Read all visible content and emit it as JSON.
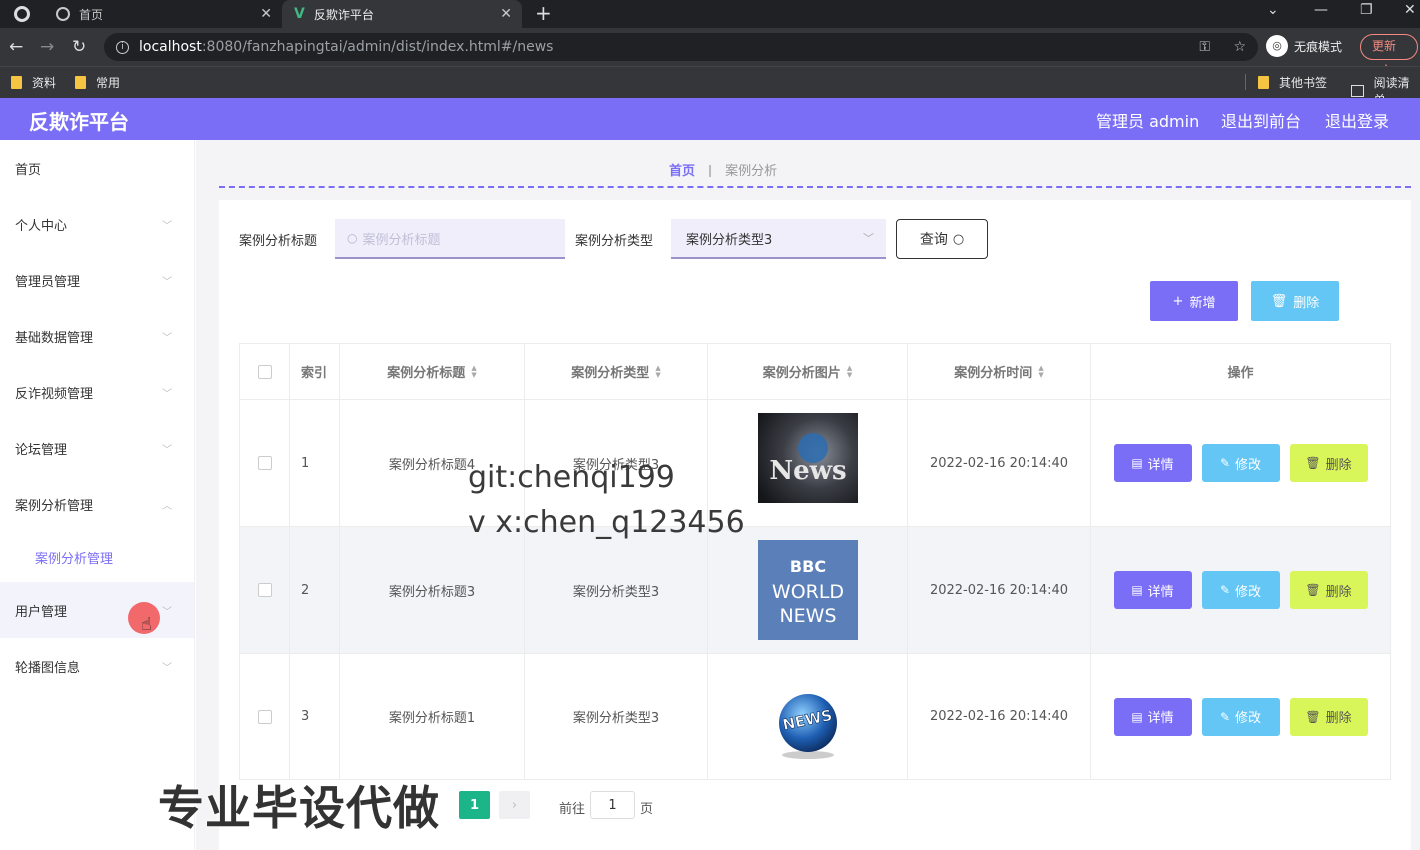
{
  "browser": {
    "tabs": [
      {
        "title": "首页"
      },
      {
        "title": "反欺诈平台"
      }
    ],
    "url_host": "localhost",
    "url_path": ":8080/fanzhapingtai/admin/dist/index.html#/news",
    "incognito_label": "无痕模式",
    "update_label": "更新",
    "bookmarks": [
      "资料",
      "常用",
      "其他书签",
      "阅读清单"
    ]
  },
  "header": {
    "brand": "反欺诈平台",
    "admin_label": "管理员 admin",
    "front_label": "退出到前台",
    "logout_label": "退出登录"
  },
  "sidebar": {
    "items": [
      "首页",
      "个人中心",
      "管理员管理",
      "基础数据管理",
      "反诈视频管理",
      "论坛管理",
      "案例分析管理",
      "用户管理",
      "轮播图信息"
    ],
    "sub_item": "案例分析管理"
  },
  "breadcrumb": {
    "home": "首页",
    "current": "案例分析"
  },
  "search": {
    "title_label": "案例分析标题",
    "title_placeholder": "案例分析标题",
    "type_label": "案例分析类型",
    "type_value": "案例分析类型3",
    "query_label": "查询"
  },
  "toolbar": {
    "add_label": "新增",
    "delete_label": "删除"
  },
  "table": {
    "columns": [
      "索引",
      "案例分析标题",
      "案例分析类型",
      "案例分析图片",
      "案例分析时间",
      "操作"
    ],
    "rows": [
      {
        "index": "1",
        "title": "案例分析标题4",
        "type": "案例分析类型3",
        "image": "news-dark",
        "time": "2022-02-16 20:14:40"
      },
      {
        "index": "2",
        "title": "案例分析标题3",
        "type": "案例分析类型3",
        "image": "bbc-world-news",
        "time": "2022-02-16 20:14:40"
      },
      {
        "index": "3",
        "title": "案例分析标题1",
        "type": "案例分析类型3",
        "image": "news-globe",
        "time": "2022-02-16 20:14:40"
      }
    ],
    "actions": {
      "detail": "详情",
      "edit": "修改",
      "remove": "删除"
    }
  },
  "pager": {
    "current_page": "1",
    "goto_prefix": "前往",
    "goto_value": "1",
    "goto_suffix": "页"
  },
  "watermark": {
    "line1": "git:chenqi199",
    "line2": "v x:chen_q123456",
    "big": "专业毕设代做"
  },
  "thumb_text": {
    "news1": "News",
    "bbc": "BBC",
    "world": "WORLD",
    "news2": "NEWS",
    "news3": "NEWS"
  },
  "colors": {
    "accent": "#7b6ef6",
    "info": "#63c6f5",
    "lime": "#d8f55a",
    "page_active": "#1cb58a"
  }
}
